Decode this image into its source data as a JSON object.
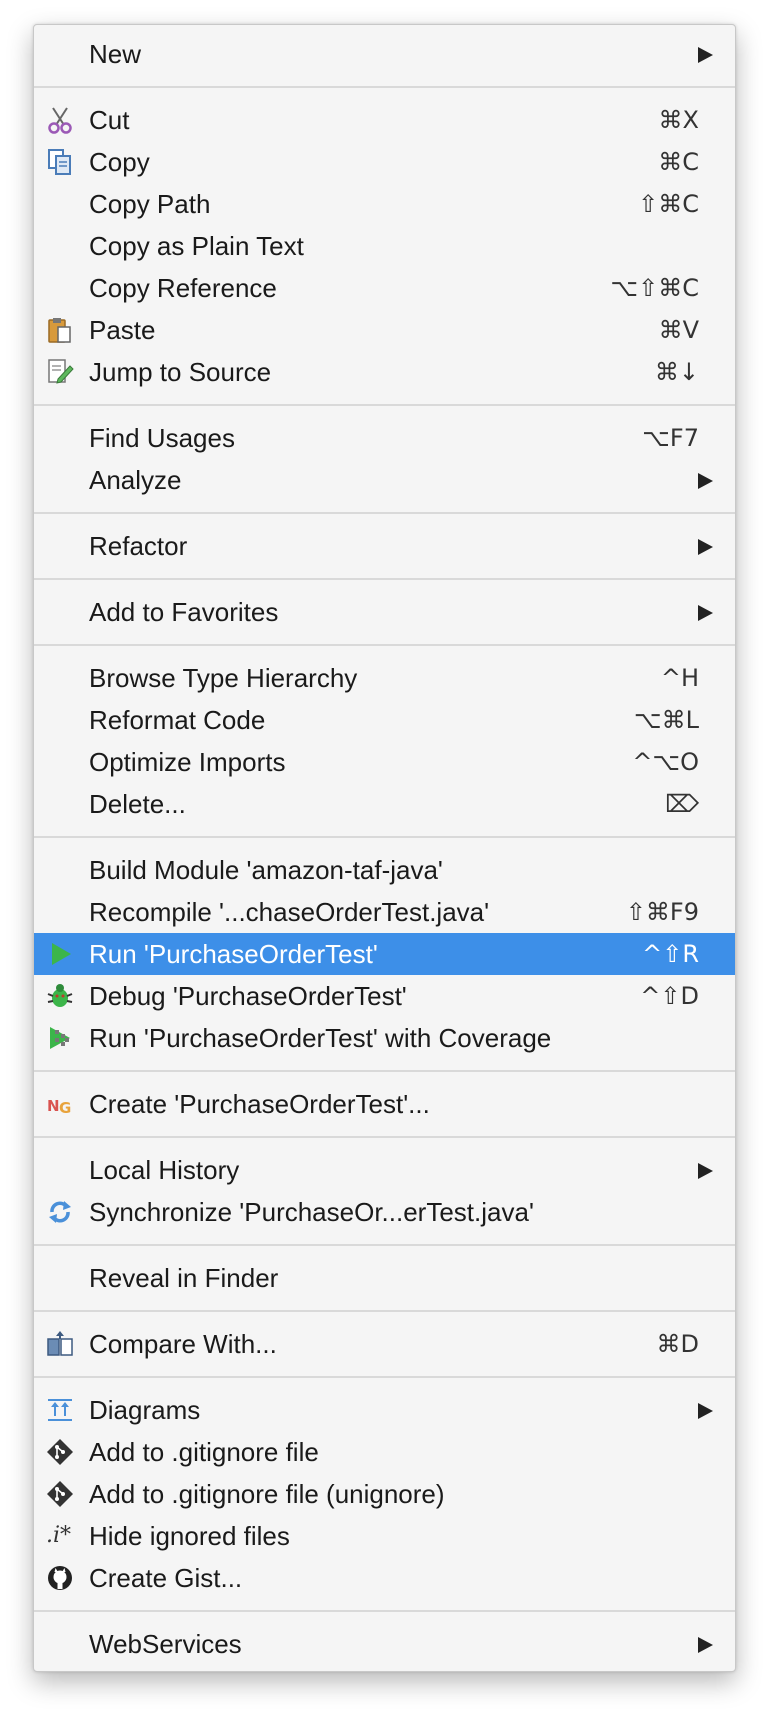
{
  "menu": {
    "groups": [
      [
        {
          "label": "New",
          "submenu": true,
          "icon": ""
        }
      ],
      [
        {
          "label": "Cut",
          "shortcut": "⌘X",
          "icon": "scissors-icon"
        },
        {
          "label": "Copy",
          "shortcut": "⌘C",
          "icon": "copy-icon"
        },
        {
          "label": "Copy Path",
          "shortcut": "⇧⌘C",
          "icon": ""
        },
        {
          "label": "Copy as Plain Text",
          "shortcut": "",
          "icon": ""
        },
        {
          "label": "Copy Reference",
          "shortcut": "⌥⇧⌘C",
          "icon": ""
        },
        {
          "label": "Paste",
          "shortcut": "⌘V",
          "icon": "paste-icon"
        },
        {
          "label": "Jump to Source",
          "shortcut": "⌘↓",
          "icon": "edit-source-icon"
        }
      ],
      [
        {
          "label": "Find Usages",
          "shortcut": "⌥F7",
          "icon": ""
        },
        {
          "label": "Analyze",
          "submenu": true,
          "icon": ""
        }
      ],
      [
        {
          "label": "Refactor",
          "submenu": true,
          "icon": ""
        }
      ],
      [
        {
          "label": "Add to Favorites",
          "submenu": true,
          "icon": ""
        }
      ],
      [
        {
          "label": "Browse Type Hierarchy",
          "shortcut": "^H",
          "icon": ""
        },
        {
          "label": "Reformat Code",
          "shortcut": "⌥⌘L",
          "icon": ""
        },
        {
          "label": "Optimize Imports",
          "shortcut": "^⌥O",
          "icon": ""
        },
        {
          "label": "Delete...",
          "shortcut": "⌦",
          "icon": ""
        }
      ],
      [
        {
          "label": "Build Module 'amazon-taf-java'",
          "shortcut": "",
          "icon": ""
        },
        {
          "label": "Recompile '...chaseOrderTest.java'",
          "shortcut": "⇧⌘F9",
          "icon": ""
        },
        {
          "label": "Run 'PurchaseOrderTest'",
          "shortcut": "^⇧R",
          "icon": "run-icon",
          "selected": true
        },
        {
          "label": "Debug 'PurchaseOrderTest'",
          "shortcut": "^⇧D",
          "icon": "debug-icon"
        },
        {
          "label": "Run 'PurchaseOrderTest' with Coverage",
          "shortcut": "",
          "icon": "coverage-icon"
        }
      ],
      [
        {
          "label": "Create 'PurchaseOrderTest'...",
          "shortcut": "",
          "icon": "testng-icon"
        }
      ],
      [
        {
          "label": "Local History",
          "submenu": true,
          "icon": ""
        },
        {
          "label": "Synchronize 'PurchaseOr...erTest.java'",
          "shortcut": "",
          "icon": "sync-icon"
        }
      ],
      [
        {
          "label": "Reveal in Finder",
          "shortcut": "",
          "icon": ""
        }
      ],
      [
        {
          "label": "Compare With...",
          "shortcut": "⌘D",
          "icon": "compare-icon"
        }
      ],
      [
        {
          "label": "Diagrams",
          "submenu": true,
          "icon": "diagram-icon"
        },
        {
          "label": "Add to .gitignore file",
          "shortcut": "",
          "icon": "git-icon"
        },
        {
          "label": "Add to .gitignore file (unignore)",
          "shortcut": "",
          "icon": "git-icon"
        },
        {
          "label": "Hide ignored files",
          "shortcut": "",
          "icon": "ignore-pattern-icon",
          "icon_text": ".i*"
        },
        {
          "label": "Create Gist...",
          "shortcut": "",
          "icon": "github-icon"
        }
      ],
      [
        {
          "label": "WebServices",
          "submenu": true,
          "icon": ""
        }
      ]
    ]
  },
  "colors": {
    "selection": "#3d8fe8",
    "run_green": "#3cb54a",
    "icon_blue": "#4a90d9",
    "paste_orange": "#d89a3c"
  }
}
